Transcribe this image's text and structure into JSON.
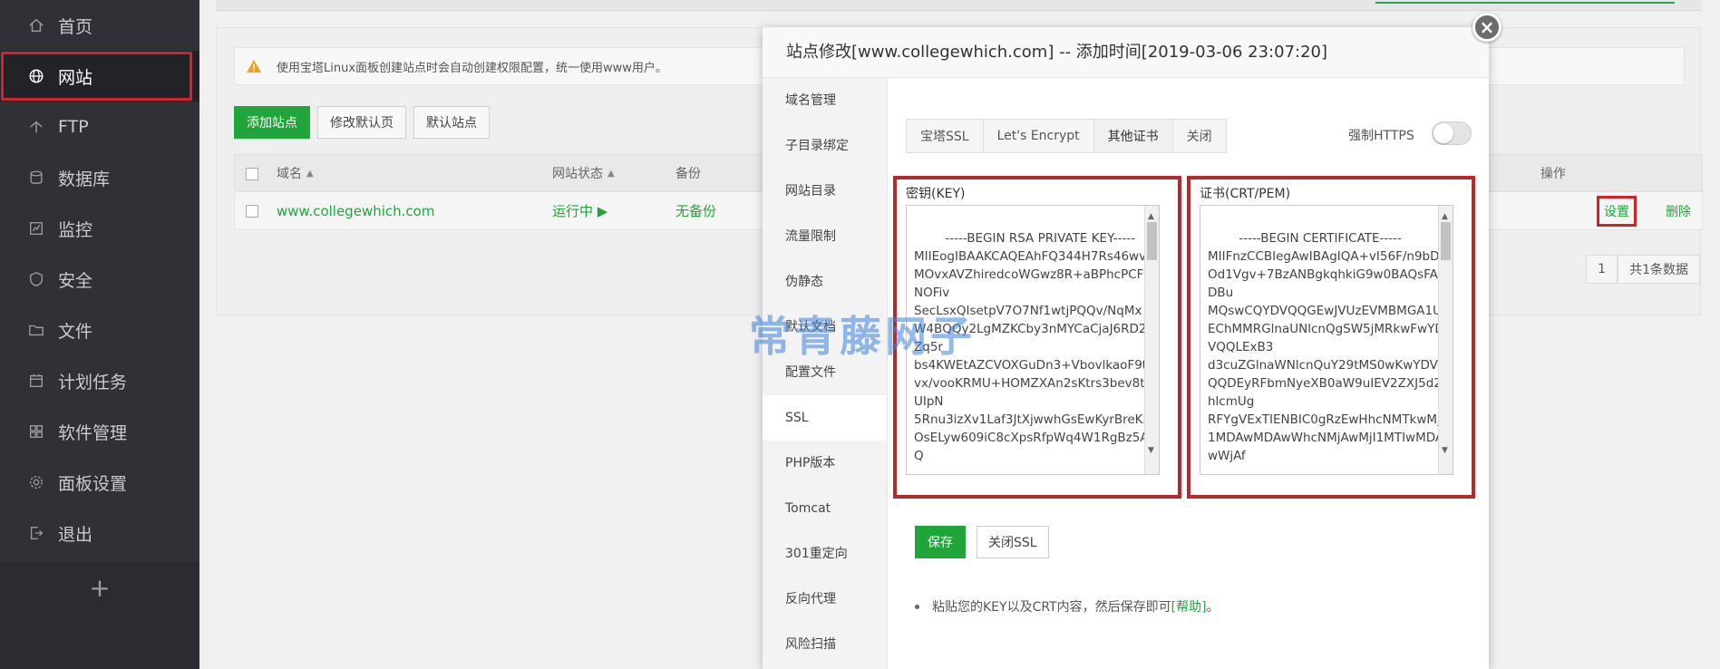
{
  "sidebar": {
    "items": [
      {
        "label": "首页",
        "icon": "home-icon"
      },
      {
        "label": "网站",
        "icon": "globe-icon"
      },
      {
        "label": "FTP",
        "icon": "ftp-icon"
      },
      {
        "label": "数据库",
        "icon": "database-icon"
      },
      {
        "label": "监控",
        "icon": "monitor-icon"
      },
      {
        "label": "安全",
        "icon": "shield-icon"
      },
      {
        "label": "文件",
        "icon": "folder-icon"
      },
      {
        "label": "计划任务",
        "icon": "calendar-icon"
      },
      {
        "label": "软件管理",
        "icon": "apps-icon"
      },
      {
        "label": "面板设置",
        "icon": "gear-icon"
      },
      {
        "label": "退出",
        "icon": "logout-icon"
      }
    ],
    "plus": "+"
  },
  "main": {
    "notice": "使用宝塔Linux面板创建站点时会自动创建权限配置，统一使用www用户。",
    "buttons": {
      "add": "添加站点",
      "edit_default": "修改默认页",
      "default_site": "默认站点"
    },
    "table": {
      "headers": {
        "domain": "域名",
        "status": "网站状态",
        "backup": "备份",
        "action": "操作"
      },
      "row": {
        "domain": "www.collegewhich.com",
        "status": "运行中 ▶",
        "backup": "无备份",
        "settings": "设置",
        "delete": "删除"
      }
    },
    "pager": {
      "page": "1",
      "total": "共1条数据"
    }
  },
  "dialog": {
    "title": "站点修改[www.collegewhich.com] -- 添加时间[2019-03-06 23:07:20]",
    "close": "×",
    "menu": [
      "域名管理",
      "子目录绑定",
      "网站目录",
      "流量限制",
      "伪静态",
      "默认文档",
      "配置文件",
      "SSL",
      "PHP版本",
      "Tomcat",
      "301重定向",
      "反向代理",
      "风险扫描"
    ],
    "tabs": [
      "宝塔SSL",
      "Let's Encrypt",
      "其他证书",
      "关闭"
    ],
    "force_https": "强制HTTPS",
    "key_label": "密钥(KEY)",
    "key_text": "-----BEGIN RSA PRIVATE KEY-----\nMIIEogIBAAKCAQEAhFQ344H7Rs46wvMOvxAVZhiredcoWGwz8R+aBPhcPCFNOFiv\nSecLsxQIsetpV7O7Nf1wtjPQQv/NqMxW4BQQy2LgMZKCby3nMYCaCjaJ6RD2Zq5r\nbs4KWEtAZCVOXGuDn3+VbovlkaoF9tvx/vooKRMU+HOMZXAn2sKtrs3bev8tUIpN\n5Rnu3izXv1Laf3JtXjwwhGsEwKyrBreK5OsELyw609iC8cXpsRfpWq4W1RgBz5AQ",
    "cert_label": "证书(CRT/PEM)",
    "cert_text": "-----BEGIN CERTIFICATE-----\nMIIFnzCCBIegAwIBAgIQA+vI56F/n9bDOd1Vgv+7BzANBgkqhkiG9w0BAQsFADBu\nMQswCQYDVQQGEwJVUzEVMBMGA1UEChMMRGlnaUNlcnQgSW5jMRkwFwYDVQQLExB3\nd3cuZGlnaWNlcnQuY29tMS0wKwYDVQQDEyRFbmNyeXB0aW9uIEV2ZXJ5d2hlcmUg\nRFYgVExTIENBIC0gRzEwHhcNMTkwMjI1MDAwMDAwWhcNMjAwMjI1MTIwMDAwWjAf",
    "save": "保存",
    "close_ssl": "关闭SSL",
    "tip_prefix": "粘贴您的KEY以及CRT内容，然后保存即可",
    "tip_help": "[帮助]",
    "tip_suffix": "。"
  },
  "watermark": "常青藤网子",
  "colors": {
    "accent": "#20a53a",
    "highlight": "#d0232b",
    "sidebar": "#2f3137"
  }
}
